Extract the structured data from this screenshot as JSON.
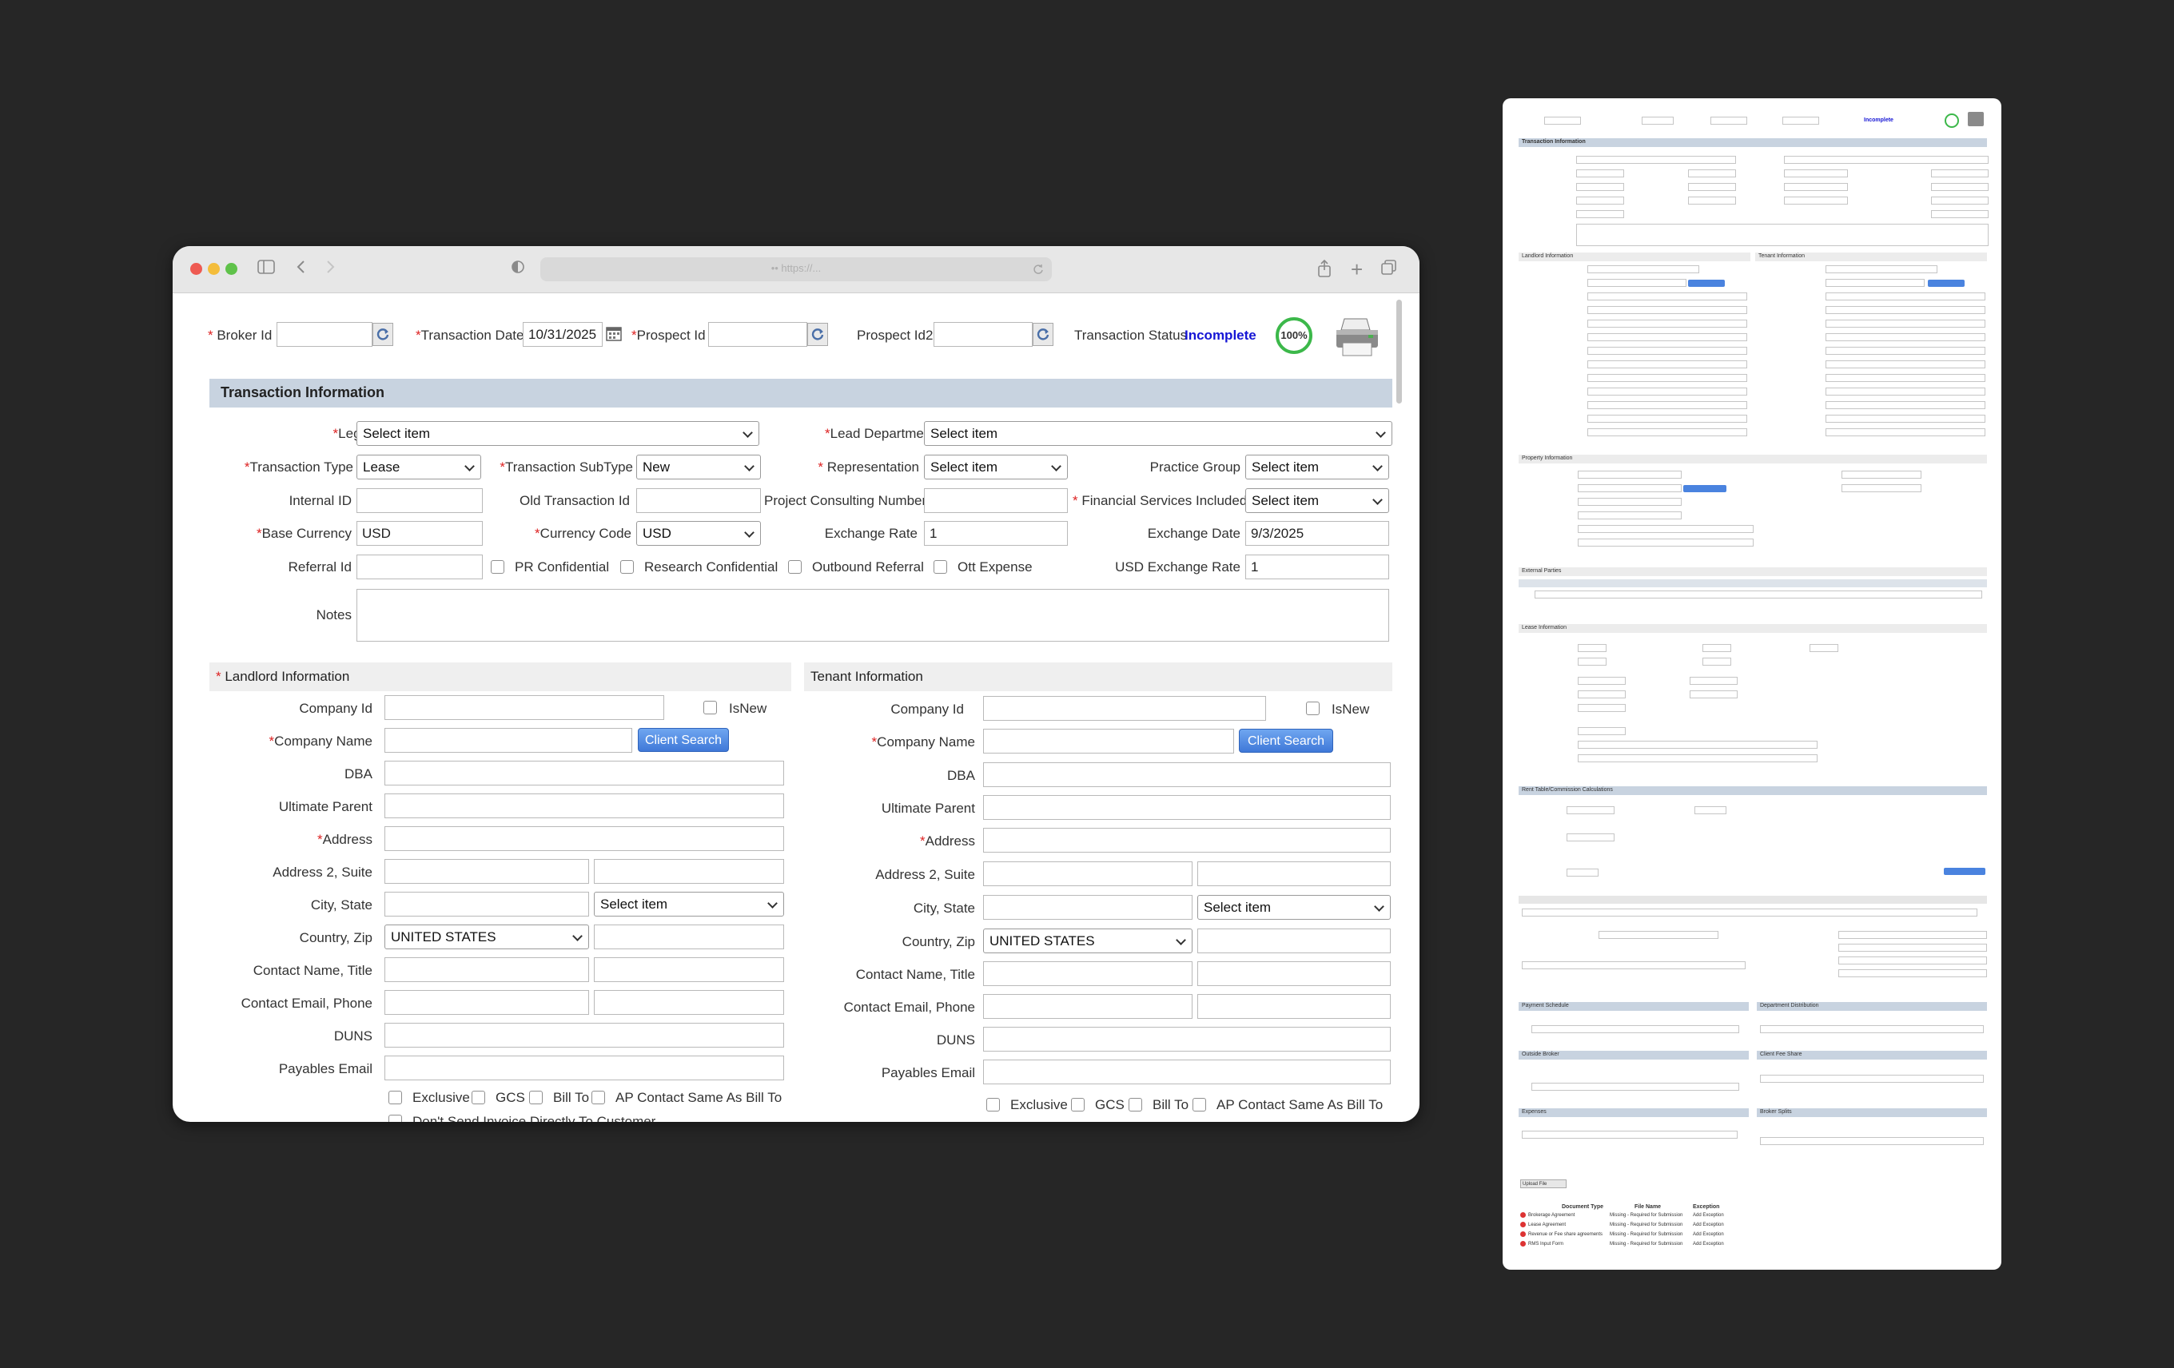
{
  "browser": {
    "url": "•• https://..."
  },
  "header": {
    "broker_id_label": "Broker Id",
    "transaction_date_label": "Transaction Date",
    "transaction_date_value": "10/31/2025",
    "prospect_id_label": "Prospect Id",
    "prospect_id2_label": "Prospect Id2",
    "transaction_status_label": "Transaction Status",
    "transaction_status_value": "Incomplete",
    "progress_percent": "100%"
  },
  "transaction_info": {
    "title": "Transaction Information",
    "legal_entity_label": "Legal Entity",
    "legal_entity_value": "Select item",
    "lead_department_label": "Lead Department",
    "lead_department_value": "Select item",
    "transaction_type_label": "Transaction Type",
    "transaction_type_value": "Lease",
    "transaction_subtype_label": "Transaction SubType",
    "transaction_subtype_value": "New",
    "representation_label": "Representation",
    "representation_value": "Select item",
    "practice_group_label": "Practice Group",
    "practice_group_value": "Select item",
    "internal_id_label": "Internal ID",
    "old_transaction_id_label": "Old Transaction Id",
    "project_consulting_label": "Project Consulting Number",
    "financial_services_label": "Financial Services Included",
    "financial_services_value": "Select item",
    "base_currency_label": "Base Currency",
    "base_currency_value": "USD",
    "currency_code_label": "Currency Code",
    "currency_code_value": "USD",
    "exchange_rate_label": "Exchange Rate",
    "exchange_rate_value": "1",
    "exchange_date_label": "Exchange Date",
    "exchange_date_value": "9/3/2025",
    "referral_id_label": "Referral Id",
    "pr_confidential_label": "PR Confidential",
    "research_confidential_label": "Research Confidential",
    "outbound_referral_label": "Outbound Referral",
    "ott_expense_label": "Ott Expense",
    "usd_exchange_rate_label": "USD Exchange Rate",
    "usd_exchange_rate_value": "1",
    "notes_label": "Notes"
  },
  "landlord": {
    "title": "Landlord Information",
    "company_id_label": "Company Id",
    "isnew_label": "IsNew",
    "company_name_label": "Company Name",
    "client_search_label": "Client Search",
    "dba_label": "DBA",
    "ultimate_parent_label": "Ultimate Parent",
    "address_label": "Address",
    "address2_label": "Address 2, Suite",
    "city_state_label": "City, State",
    "state_value": "Select item",
    "country_zip_label": "Country, Zip",
    "country_value": "UNITED STATES",
    "contact_name_label": "Contact Name, Title",
    "contact_email_label": "Contact Email, Phone",
    "duns_label": "DUNS",
    "payables_email_label": "Payables Email",
    "exclusive_label": "Exclusive",
    "gcs_label": "GCS",
    "bill_to_label": "Bill To",
    "ap_contact_label": "AP Contact Same As Bill To",
    "dont_send_label": "Don't Send Invoice Directly To Customer"
  },
  "tenant": {
    "title": "Tenant Information",
    "company_id_label": "Company Id",
    "isnew_label": "IsNew",
    "company_name_label": "Company Name",
    "client_search_label": "Client Search",
    "dba_label": "DBA",
    "ultimate_parent_label": "Ultimate Parent",
    "address_label": "Address",
    "address2_label": "Address 2, Suite",
    "city_state_label": "City, State",
    "state_value": "Select item",
    "country_zip_label": "Country, Zip",
    "country_value": "UNITED STATES",
    "contact_name_label": "Contact Name, Title",
    "contact_email_label": "Contact Email, Phone",
    "duns_label": "DUNS",
    "payables_email_label": "Payables Email",
    "exclusive_label": "Exclusive",
    "gcs_label": "GCS",
    "bill_to_label": "Bill To",
    "ap_contact_label": "AP Contact Same As Bill To"
  },
  "thumbnail": {
    "transaction_info": "Transaction Information",
    "landlord": "Landlord Information",
    "tenant": "Tenant Information",
    "property": "Property Information",
    "external_parties": "External Parties",
    "lease_info": "Lease Information",
    "rent_table": "Rent Table/Commission Calculations",
    "payment_schedule": "Payment Schedule",
    "department_distribution": "Department Distribution",
    "outside_broker": "Outside Broker",
    "client_fee_share": "Client Fee Share",
    "expenses": "Expenses",
    "broker_splits": "Broker Splits",
    "property_search": "Property Search",
    "client_search": "Client Search",
    "easy_auto_enter": "Easy Auto Enter",
    "upload_file": "Upload File",
    "doc_header_type": "Document Type",
    "doc_header_file": "File Name",
    "doc_header_exception": "Exception",
    "documents": [
      {
        "type": "Brokerage Agreement",
        "file": "Missing - Required for Submission",
        "exception": "Add Exception"
      },
      {
        "type": "Lease Agreement",
        "file": "Missing - Required for Submission",
        "exception": "Add Exception"
      },
      {
        "type": "Revenue or Fee share agreements",
        "file": "Missing - Required for Submission",
        "exception": "Add Exception"
      },
      {
        "type": "RMS Input Form",
        "file": "Missing - Required for Submission",
        "exception": "Add Exception"
      }
    ]
  }
}
